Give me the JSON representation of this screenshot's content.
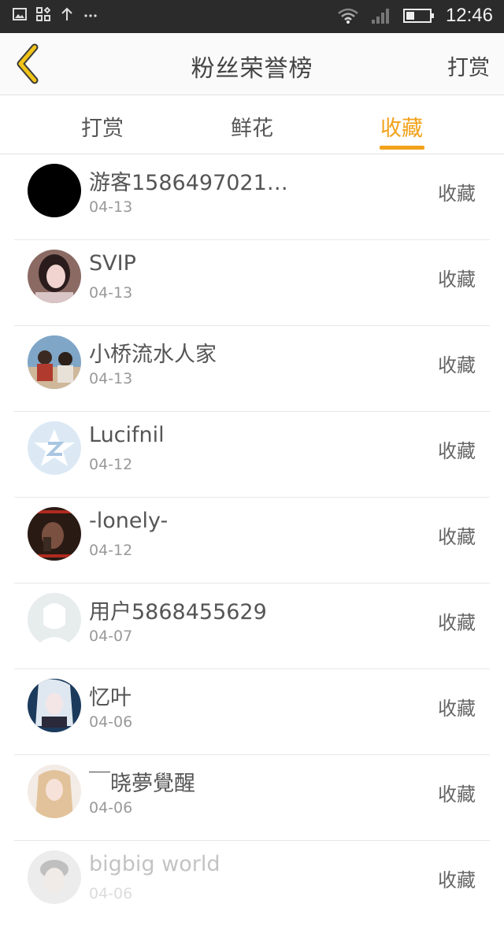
{
  "status_bar": {
    "time": "12:46"
  },
  "header": {
    "title": "粉丝荣誉榜",
    "action_label": "打赏"
  },
  "tabs": [
    {
      "label": "打赏",
      "active": false
    },
    {
      "label": "鲜花",
      "active": false
    },
    {
      "label": "收藏",
      "active": true
    }
  ],
  "colors": {
    "accent": "#f2a21b",
    "back_arrow": "#f0c419",
    "status_bar": "#2b2b2b"
  },
  "fans": [
    {
      "name": "游客1586497021…",
      "date": "04-13",
      "action": "收藏",
      "avatar": "black-avatar"
    },
    {
      "name": "SVIP",
      "date": "04-13",
      "action": "收藏",
      "avatar": "photo-girl-avatar"
    },
    {
      "name": "小桥流水人家",
      "date": "04-13",
      "action": "收藏",
      "avatar": "photo-couple-avatar"
    },
    {
      "name": "Lucifnil",
      "date": "04-12",
      "action": "收藏",
      "avatar": "default-star-avatar"
    },
    {
      "name": "-lonely-",
      "date": "04-12",
      "action": "收藏",
      "avatar": "photo-man-avatar"
    },
    {
      "name": "用户5868455629",
      "date": "04-07",
      "action": "收藏",
      "avatar": "default-silhouette-avatar"
    },
    {
      "name": "忆叶",
      "date": "04-06",
      "action": "收藏",
      "avatar": "anime-avatar"
    },
    {
      "name": "￣晓夢覺醒",
      "date": "04-06",
      "action": "收藏",
      "avatar": "photo-blonde-avatar"
    },
    {
      "name": "bigbig world",
      "date": "04-06",
      "action": "收藏",
      "avatar": "photo-face-avatar"
    }
  ]
}
